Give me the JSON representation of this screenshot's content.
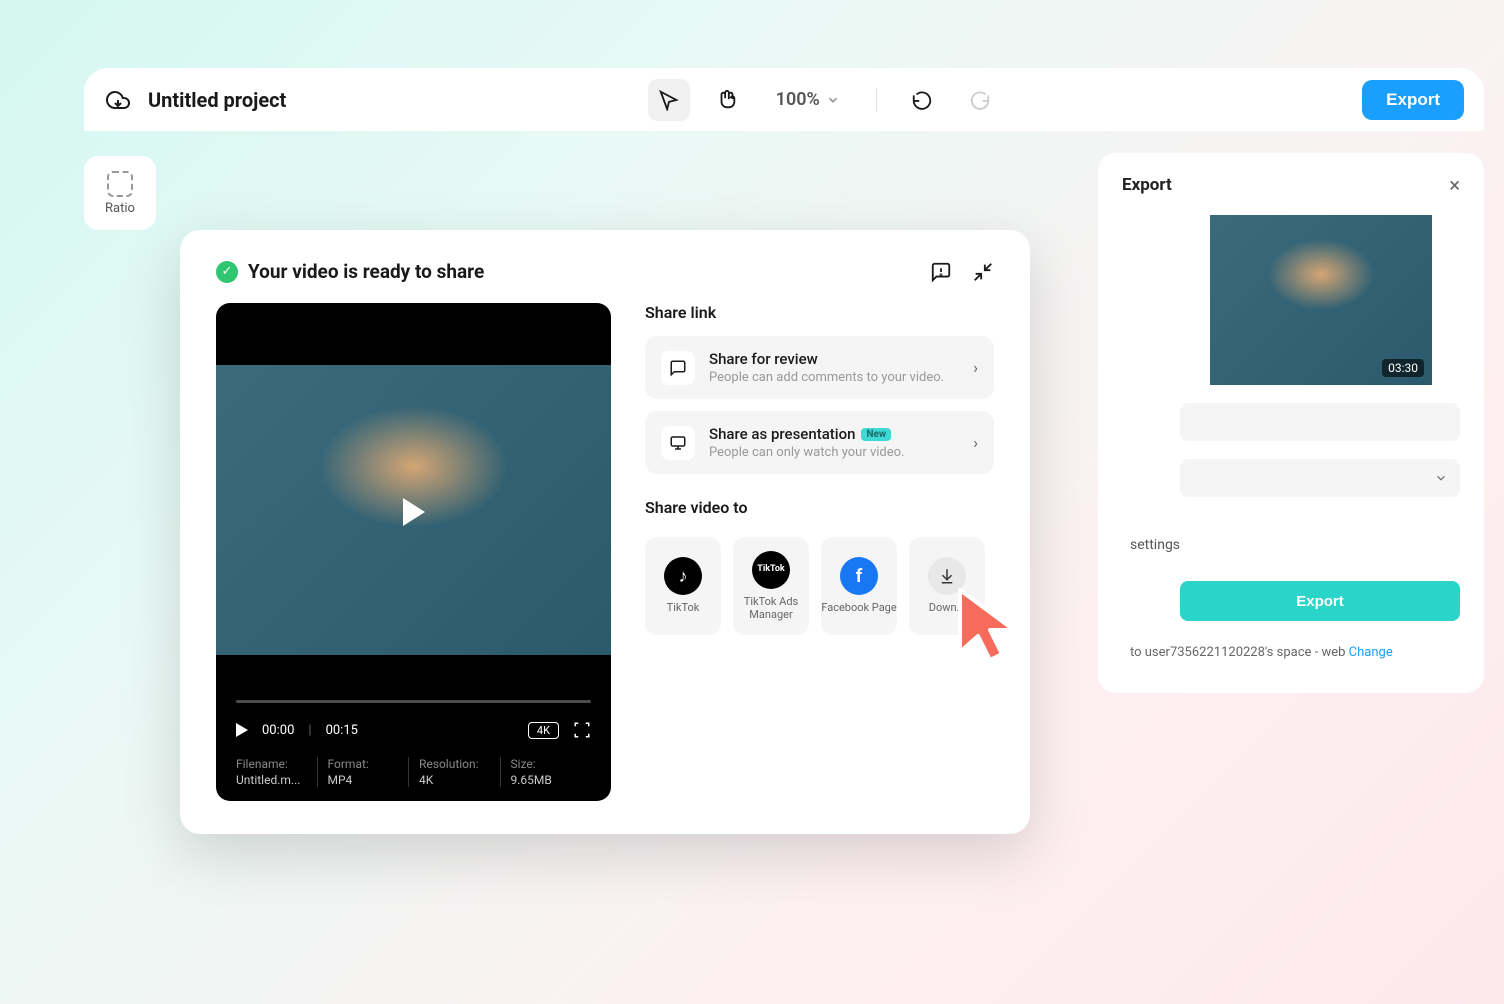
{
  "toolbar": {
    "project_title": "Untitled project",
    "zoom_level": "100%",
    "export_label": "Export"
  },
  "ratio": {
    "label": "Ratio"
  },
  "share_modal": {
    "title": "Your video is ready to share",
    "share_link_label": "Share link",
    "options": [
      {
        "title": "Share for review",
        "subtitle": "People can add comments to your video.",
        "badge": null
      },
      {
        "title": "Share as presentation",
        "subtitle": "People can only watch your video.",
        "badge": "New"
      }
    ],
    "share_video_label": "Share video to",
    "targets": [
      {
        "label": "TikTok"
      },
      {
        "label": "TikTok Ads Manager"
      },
      {
        "label": "Facebook Page"
      },
      {
        "label": "Down..."
      }
    ],
    "video": {
      "current_time": "00:00",
      "total_time": "00:15",
      "quality": "4K",
      "info": {
        "filename_label": "Filename:",
        "filename_value": "Untitled.m...",
        "format_label": "Format:",
        "format_value": "MP4",
        "resolution_label": "Resolution:",
        "resolution_value": "4K",
        "size_label": "Size:",
        "size_value": "9.65MB"
      }
    }
  },
  "export_panel": {
    "title": "Export",
    "duration": "03:30",
    "settings_label": "settings",
    "export_button": "Export",
    "footer_text": "to user7356221120228's space - web ",
    "change_link": "Change"
  }
}
